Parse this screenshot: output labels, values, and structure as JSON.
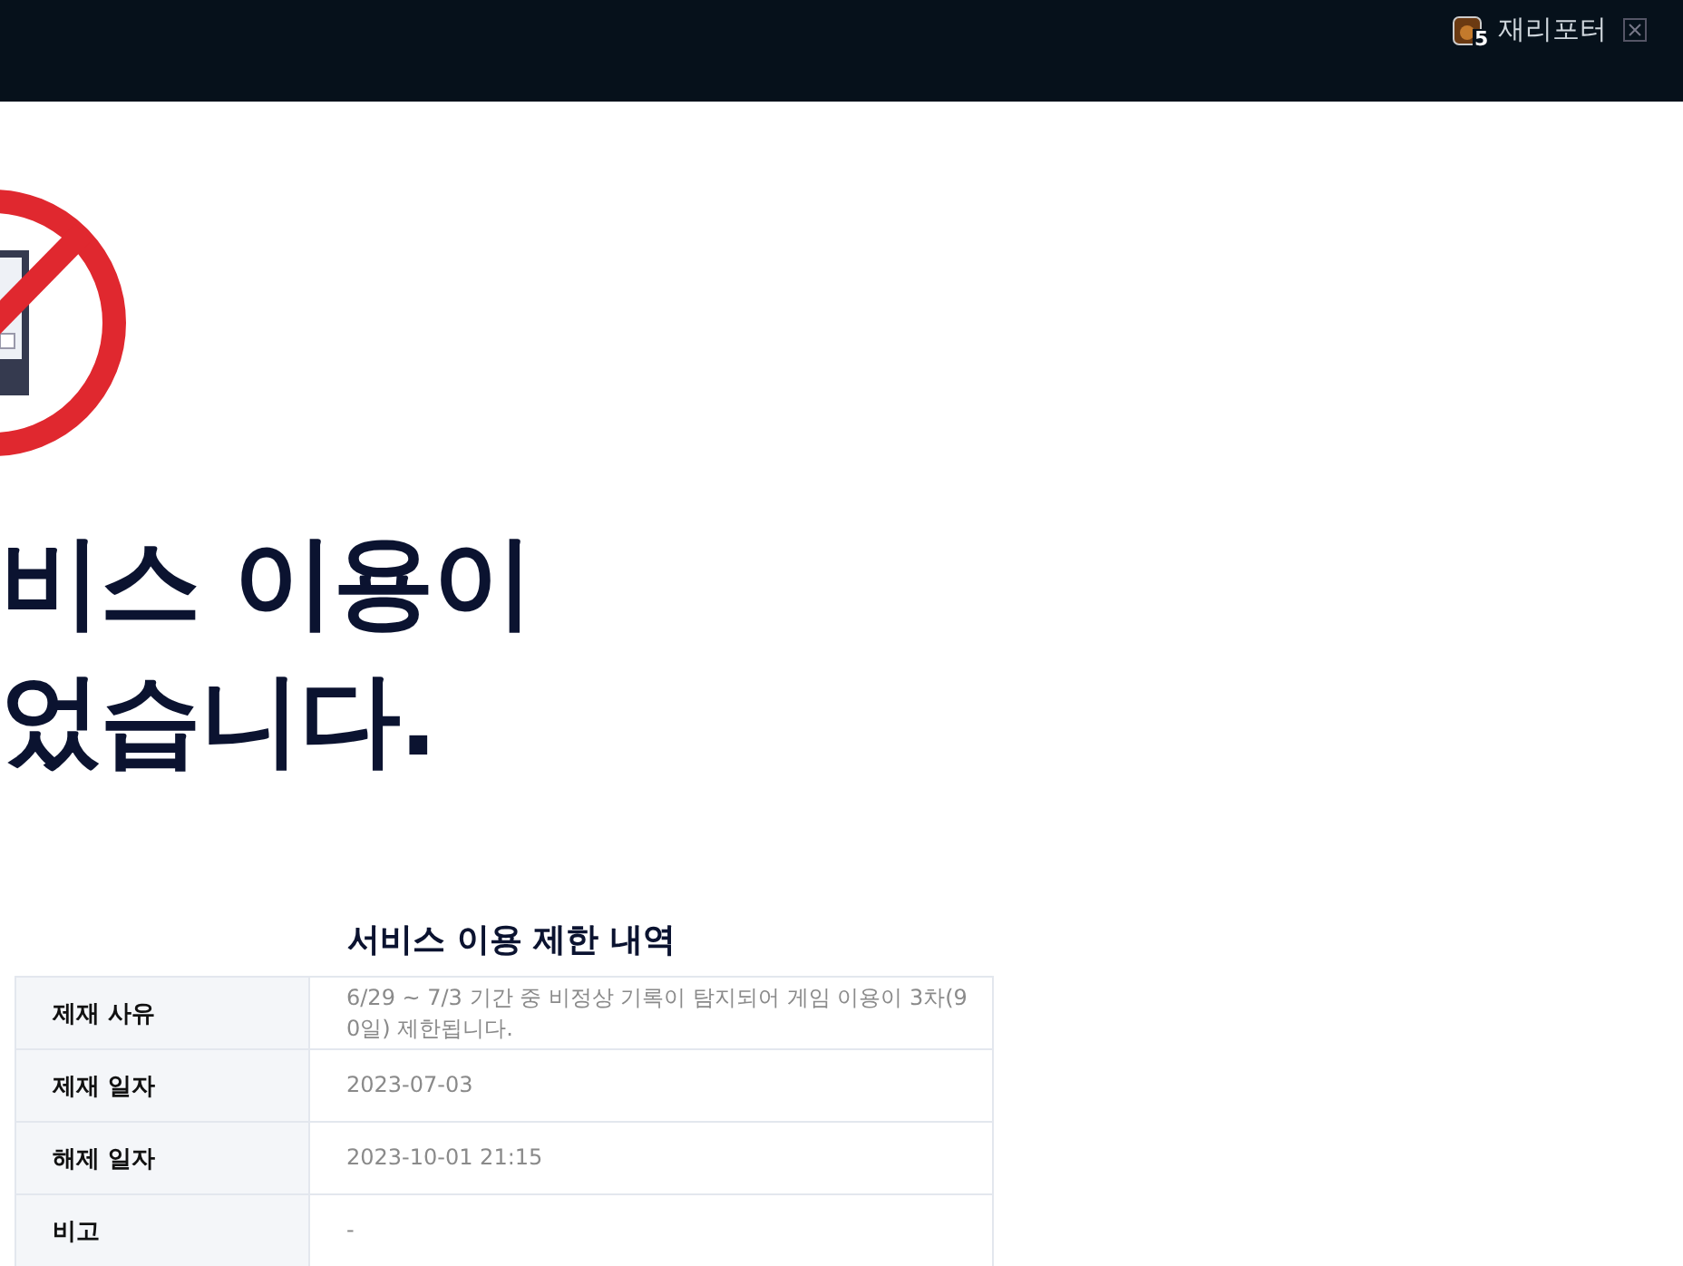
{
  "top_bar": {
    "user": {
      "name": "재리포터",
      "level_badge": "5"
    }
  },
  "headline": {
    "lines": [
      "비스 이용이",
      "었습니다."
    ]
  },
  "restriction_table": {
    "title": "서비스 이용 제한 내역",
    "rows": [
      {
        "label": "제재 사유",
        "value": "6/29 ~ 7/3 기간 중 비정상 기록이 탐지되어 게임 이용이 3차(9\n0일) 제한됩니다."
      },
      {
        "label": "제재 일자",
        "value": "2023-07-03"
      },
      {
        "label": "해제 일자",
        "value": "2023-10-01 21:15"
      },
      {
        "label": "비고",
        "value": "-"
      }
    ]
  }
}
